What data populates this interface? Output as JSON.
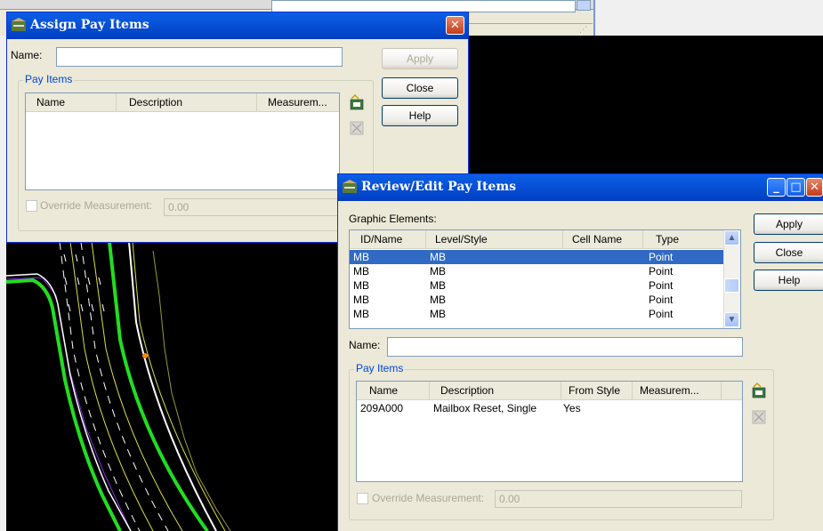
{
  "assign_dialog": {
    "title": "Assign Pay Items",
    "name_label": "Name:",
    "name_value": "",
    "apply_label": "Apply",
    "close_label": "Close",
    "help_label": "Help",
    "group_title": "Pay Items",
    "columns": [
      "Name",
      "Description",
      "Measurem..."
    ],
    "override_label": "Override Measurement:",
    "override_value": "0.00"
  },
  "review_dialog": {
    "title": "Review/Edit Pay Items",
    "graphic_elements_label": "Graphic Elements:",
    "graphic_columns": [
      "ID/Name",
      "Level/Style",
      "Cell Name",
      "Type"
    ],
    "graphic_rows": [
      {
        "id": "MB",
        "level": "MB",
        "cell": "",
        "type": "Point",
        "selected": true
      },
      {
        "id": "MB",
        "level": "MB",
        "cell": "",
        "type": "Point",
        "selected": false
      },
      {
        "id": "MB",
        "level": "MB",
        "cell": "",
        "type": "Point",
        "selected": false
      },
      {
        "id": "MB",
        "level": "MB",
        "cell": "",
        "type": "Point",
        "selected": false
      },
      {
        "id": "MB",
        "level": "MB",
        "cell": "",
        "type": "Point",
        "selected": false
      }
    ],
    "apply_label": "Apply",
    "close_label": "Close",
    "help_label": "Help",
    "name_label": "Name:",
    "name_value": "",
    "group_title": "Pay Items",
    "pay_columns": [
      "Name",
      "Description",
      "From Style",
      "Measurem..."
    ],
    "pay_rows": [
      {
        "name": "209A000",
        "description": "Mailbox Reset, Single",
        "from_style": "Yes",
        "measurement": ""
      }
    ],
    "override_label": "Override Measurement:",
    "override_value": "0.00"
  },
  "colors": {
    "titlebar": "#0852d8",
    "dialog_bg": "#ece9d8",
    "selection": "#316ac5",
    "cad_bg": "#000000",
    "road_green": "#22dd22"
  }
}
